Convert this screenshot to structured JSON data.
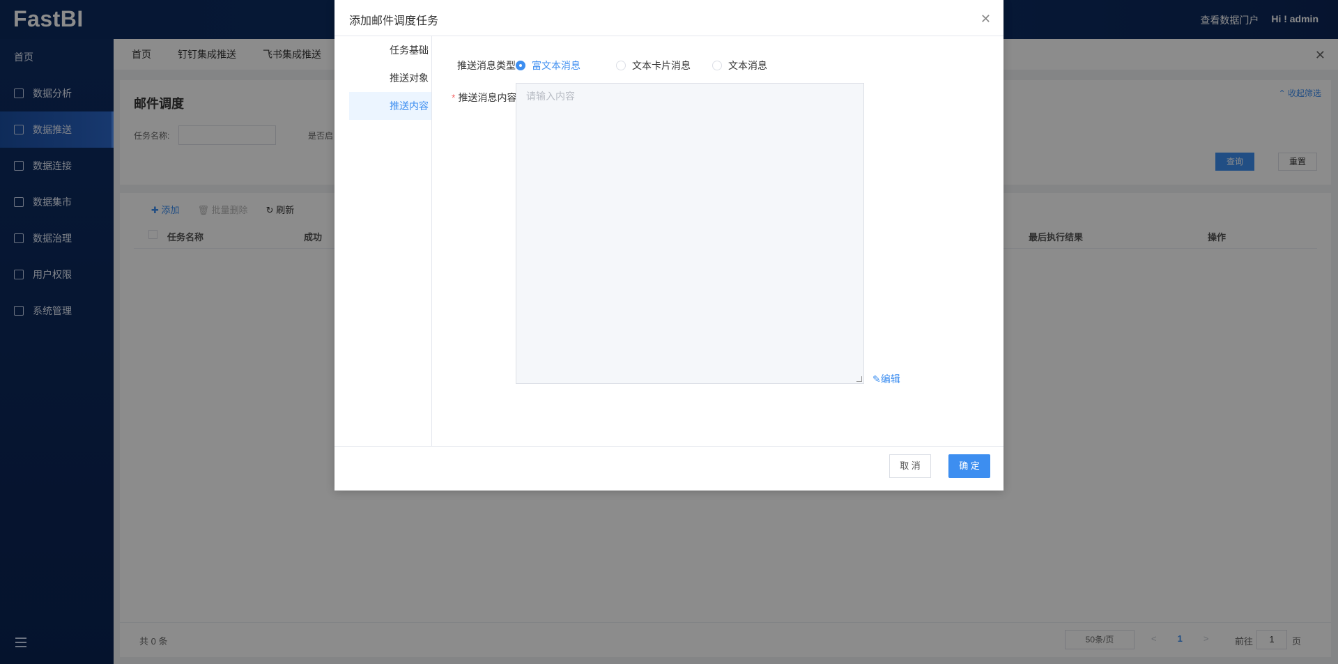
{
  "header": {
    "logo": "FastBI",
    "view_portal": "查看数据门户",
    "greeting": "Hi ! admin"
  },
  "sidebar": {
    "home": "首页",
    "items": [
      {
        "label": "数据分析",
        "icon": "chart-icon"
      },
      {
        "label": "数据推送",
        "icon": "bar-icon",
        "active": true
      },
      {
        "label": "数据连接",
        "icon": "connect-icon"
      },
      {
        "label": "数据集市",
        "icon": "monitor-icon"
      },
      {
        "label": "数据治理",
        "icon": "layers-icon"
      },
      {
        "label": "用户权限",
        "icon": "user-icon"
      },
      {
        "label": "系统管理",
        "icon": "users-icon"
      }
    ]
  },
  "tabs": [
    "首页",
    "钉钉集成推送",
    "飞书集成推送"
  ],
  "filter": {
    "title": "邮件调度",
    "collapse": "收起筛选",
    "task_name_label": "任务名称:",
    "enabled_label": "是否启",
    "query": "查询",
    "reset": "重置"
  },
  "toolbar": {
    "add": "添加",
    "batch_delete": "批量删除",
    "refresh": "刷新"
  },
  "table": {
    "columns": [
      "任务名称",
      "成功",
      "最后执行结果",
      "操作"
    ],
    "total": "共 0 条",
    "page_size": "50条/页",
    "prev": "<",
    "current_page": "1",
    "next": ">",
    "goto_prefix": "前往",
    "goto_value": "1",
    "goto_suffix": "页"
  },
  "dialog": {
    "title": "添加邮件调度任务",
    "nav": [
      "任务基础",
      "推送对象",
      "推送内容"
    ],
    "type_label": "推送消息类型",
    "types": [
      "富文本消息",
      "文本卡片消息",
      "文本消息"
    ],
    "selected_type": "富文本消息",
    "content_label": "推送消息内容",
    "content_placeholder": "请输入内容",
    "edit": "编辑",
    "cancel": "取 消",
    "ok": "确 定"
  }
}
